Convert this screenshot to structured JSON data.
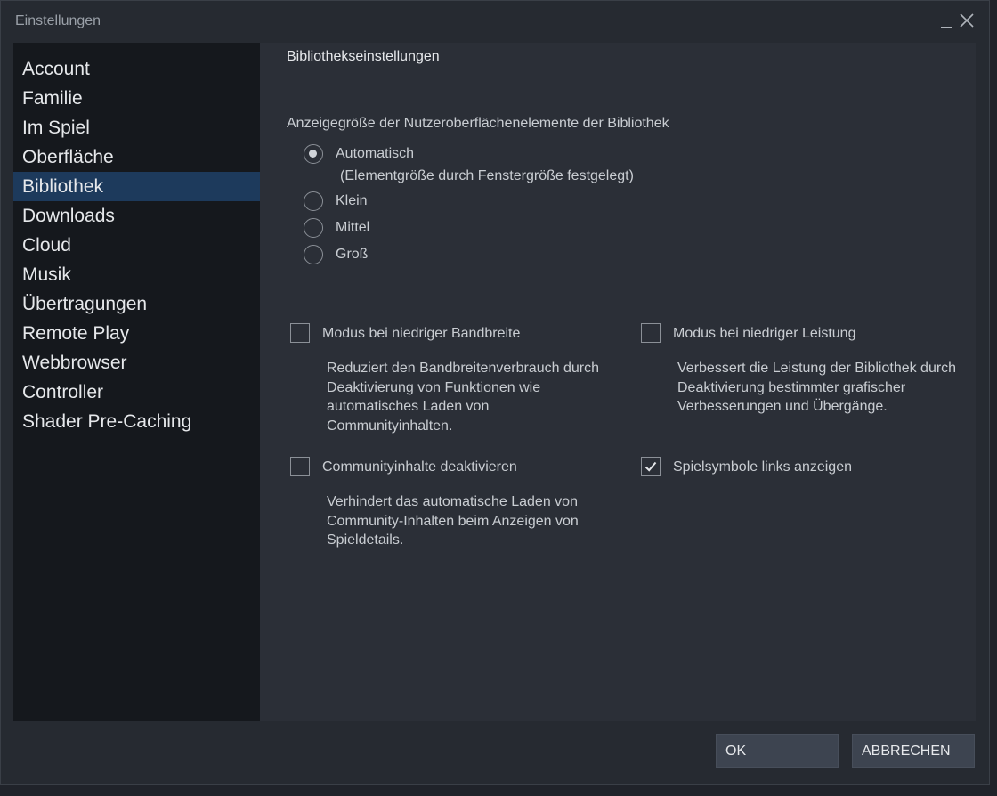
{
  "window": {
    "title": "Einstellungen"
  },
  "sidebar": {
    "items": [
      {
        "label": "Account"
      },
      {
        "label": "Familie"
      },
      {
        "label": "Im Spiel"
      },
      {
        "label": "Oberfläche"
      },
      {
        "label": "Bibliothek",
        "active": true
      },
      {
        "label": "Downloads"
      },
      {
        "label": "Cloud"
      },
      {
        "label": "Musik"
      },
      {
        "label": "Übertragungen"
      },
      {
        "label": "Remote Play"
      },
      {
        "label": "Webbrowser"
      },
      {
        "label": "Controller"
      },
      {
        "label": "Shader Pre-Caching"
      }
    ]
  },
  "main": {
    "section_title": "Bibliothekseinstellungen",
    "size_group": {
      "label": "Anzeigegröße der Nutzeroberflächenelemente der Bibliothek",
      "options": [
        {
          "label": "Automatisch",
          "selected": true
        },
        {
          "label": "Klein",
          "selected": false
        },
        {
          "label": "Mittel",
          "selected": false
        },
        {
          "label": "Groß",
          "selected": false
        }
      ],
      "auto_note": "(Elementgröße durch Fenstergröße festgelegt)"
    },
    "options": {
      "low_bandwidth": {
        "label": "Modus bei niedriger Bandbreite",
        "checked": false,
        "description": "Reduziert den Bandbreitenverbrauch durch Deaktivierung von Funktionen wie automatisches Laden von Communityinhalten."
      },
      "low_performance": {
        "label": "Modus bei niedriger Leistung",
        "checked": false,
        "description": "Verbessert die Leistung der Bibliothek durch Deaktivierung bestimmter grafischer Verbesserungen und Übergänge."
      },
      "disable_community": {
        "label": "Communityinhalte deaktivieren",
        "checked": false,
        "description": "Verhindert das automatische Laden von Community-Inhalten beim Anzeigen von Spieldetails."
      },
      "game_icons_left": {
        "label": "Spielsymbole links anzeigen",
        "checked": true
      }
    }
  },
  "footer": {
    "ok_label": "OK",
    "cancel_label": "ABBRECHEN"
  }
}
